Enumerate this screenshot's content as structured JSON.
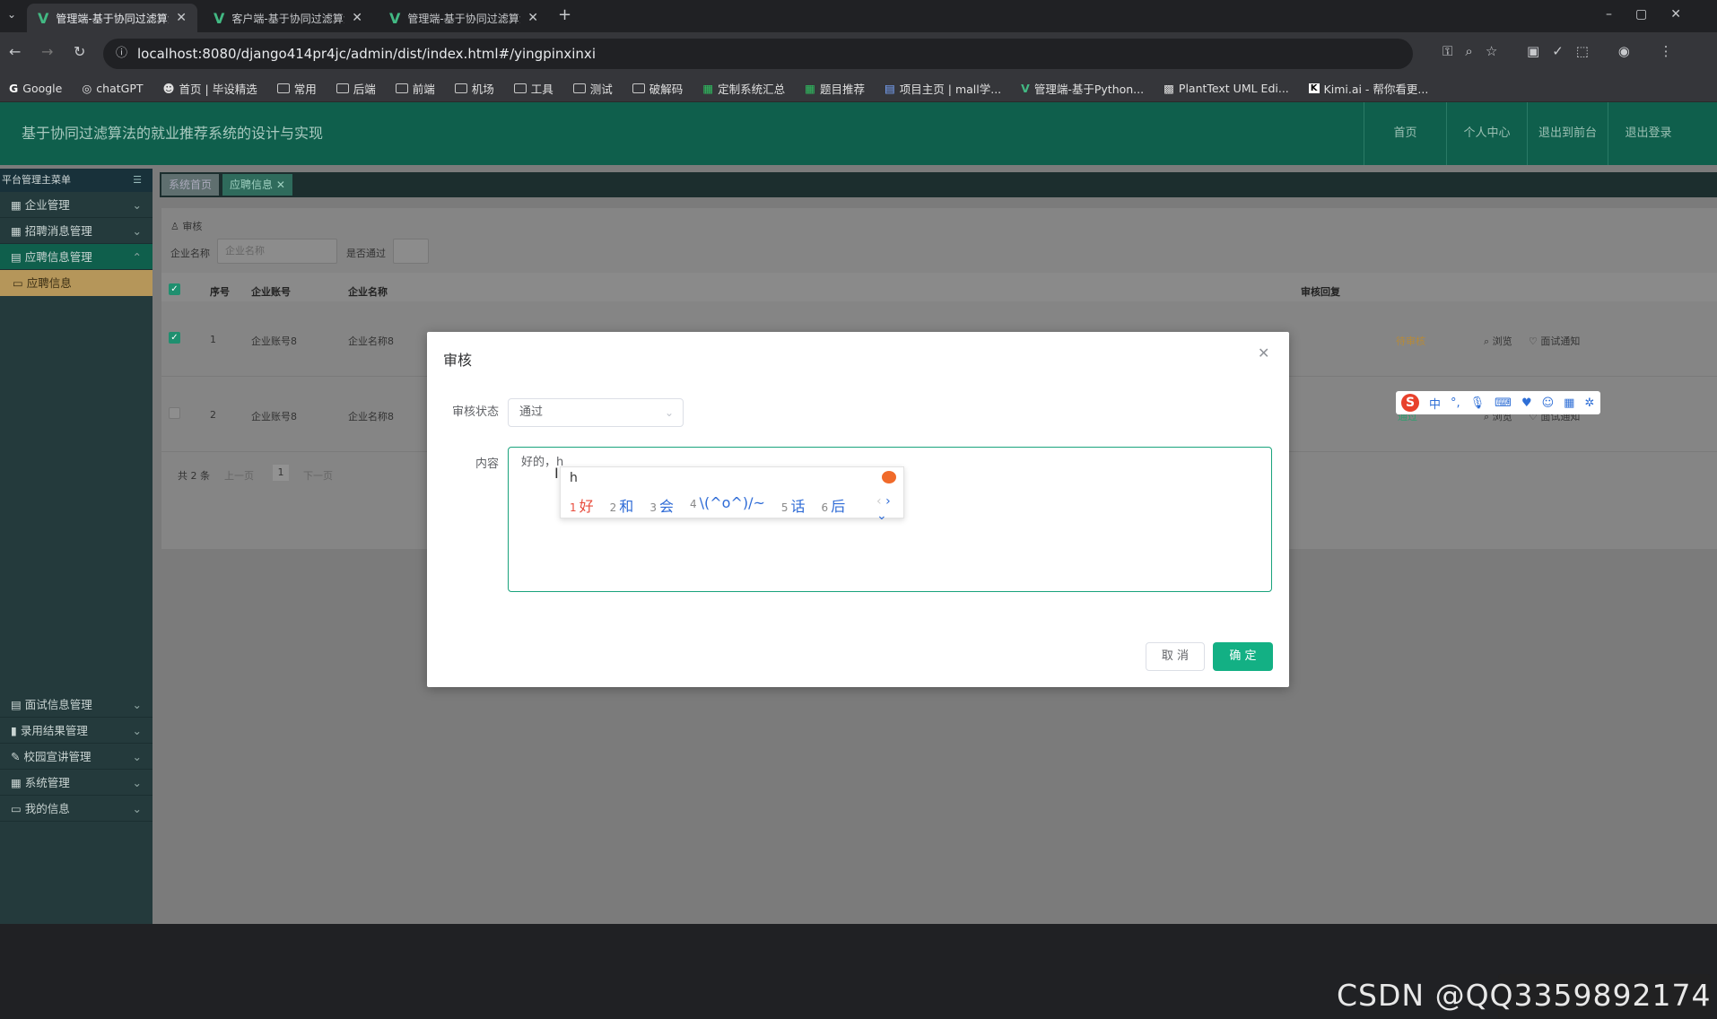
{
  "browser": {
    "tabs": [
      {
        "title": "管理端-基于协同过滤算法的就",
        "active": true
      },
      {
        "title": "客户端-基于协同过滤算法的就",
        "active": false
      },
      {
        "title": "管理端-基于协同过滤算法的就",
        "active": false
      }
    ],
    "url": "localhost:8080/django414pr4jc/admin/dist/index.html#/yingpinxinxi",
    "bookmarks": [
      "Google",
      "chatGPT",
      "首页 | 毕设精选",
      "常用",
      "后端",
      "前端",
      "机场",
      "工具",
      "测试",
      "破解码",
      "定制系统汇总",
      "题目推荐",
      "项目主页 | mall学...",
      "管理端-基于Python...",
      "PlantText UML Edi...",
      "Kimi.ai - 帮你看更..."
    ]
  },
  "header": {
    "title": "基于协同过滤算法的就业推荐系统的设计与实现",
    "nav": [
      "首页",
      "个人中心",
      "退出到前台",
      "退出登录"
    ]
  },
  "sidebar": {
    "heading": "平台管理主菜单",
    "items_top": [
      "企业管理",
      "招聘消息管理",
      "应聘信息管理"
    ],
    "sub_item": "应聘信息",
    "items_bottom": [
      "面试信息管理",
      "录用结果管理",
      "校园宣讲管理",
      "系统管理",
      "我的信息"
    ]
  },
  "page_tabs": [
    "系统首页",
    "应聘信息"
  ],
  "content": {
    "audit_label": "审核",
    "search_company_label": "企业名称",
    "search_company_placeholder": "企业名称",
    "passed_label": "是否通过",
    "columns": [
      "序号",
      "企业账号",
      "企业名称",
      "审核回复"
    ],
    "rows": [
      {
        "no": "1",
        "account": "企业账号8",
        "name": "企业名称8",
        "status": "待审核",
        "checked": true
      },
      {
        "no": "2",
        "account": "企业账号8",
        "name": "企业名称8",
        "status": "通过",
        "checked": false
      }
    ],
    "row_actions": [
      "浏览",
      "面试通知"
    ],
    "pagination": {
      "total": "共 2 条",
      "prev": "上一页",
      "page": "1",
      "next": "下一页"
    }
  },
  "modal": {
    "title": "审核",
    "status_label": "审核状态",
    "status_value": "通过",
    "content_label": "内容",
    "content_value": "好的，h",
    "cancel": "取 消",
    "confirm": "确 定"
  },
  "ime": {
    "input": "h",
    "candidates": [
      {
        "n": "1",
        "t": "好"
      },
      {
        "n": "2",
        "t": "和"
      },
      {
        "n": "3",
        "t": "会"
      },
      {
        "n": "4",
        "t": "\\(^o^)/~"
      },
      {
        "n": "5",
        "t": "话"
      },
      {
        "n": "6",
        "t": "后"
      }
    ]
  },
  "sogou_toolbar": {
    "mode": "中"
  },
  "watermark": "CSDN @QQ3359892174",
  "colors": {
    "header": "#0f5f4c",
    "accent": "#13b084",
    "sidebar": "#243a3c"
  }
}
